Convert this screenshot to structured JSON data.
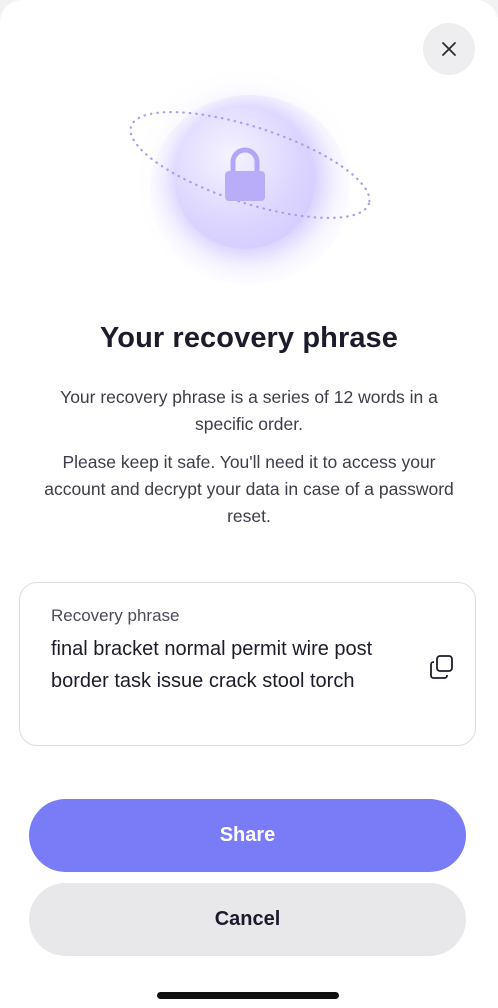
{
  "header": {
    "close_icon": "close-icon"
  },
  "illustration": {
    "icon": "lock-icon",
    "accent_color": "#b9adfa"
  },
  "content": {
    "title": "Your recovery phrase",
    "description_1": "Your recovery phrase is a series of 12 words in a specific order.",
    "description_2": "Please keep it safe. You'll need it to access your account and decrypt your data in case of a password reset."
  },
  "phrase_card": {
    "label": "Recovery phrase",
    "value": "final bracket normal permit wire post border task issue crack stool torch",
    "copy_icon": "copy-icon"
  },
  "actions": {
    "share_label": "Share",
    "cancel_label": "Cancel",
    "share_color": "#7a7cf7",
    "cancel_color": "#e8e8eb"
  }
}
